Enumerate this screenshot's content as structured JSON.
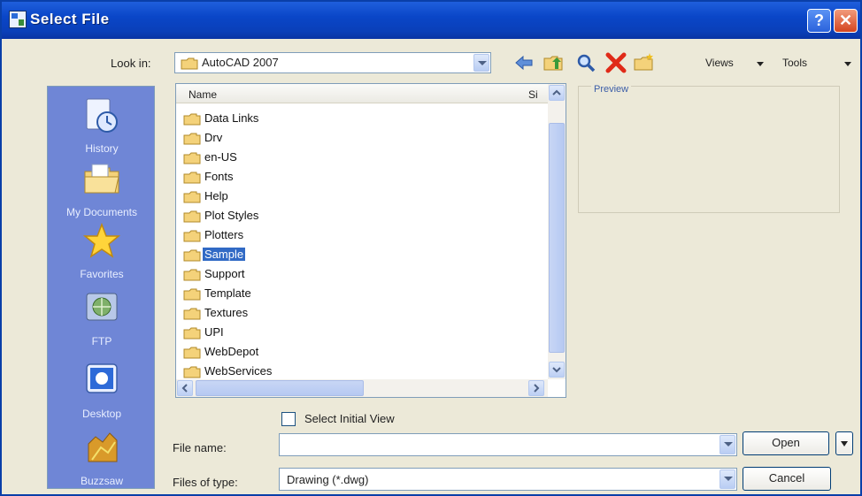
{
  "window": {
    "title": "Select File",
    "help_label": "?",
    "close_label": "✕"
  },
  "lookin": {
    "label": "Look in:",
    "value": "AutoCAD 2007"
  },
  "toolbar": {
    "icons": [
      "back-arrow-icon",
      "up-folder-icon",
      "search-web-icon",
      "delete-icon",
      "create-folder-icon"
    ],
    "views_label": "Views",
    "tools_label": "Tools"
  },
  "places": [
    {
      "label": "History",
      "icon": "history-icon"
    },
    {
      "label": "My Documents",
      "icon": "my-documents-icon"
    },
    {
      "label": "Favorites",
      "icon": "favorites-icon"
    },
    {
      "label": "FTP",
      "icon": "ftp-icon"
    },
    {
      "label": "Desktop",
      "icon": "desktop-icon"
    },
    {
      "label": "Buzzsaw",
      "icon": "buzzsaw-icon"
    }
  ],
  "filelist": {
    "col_name": "Name",
    "col_size": "Si",
    "items": [
      {
        "name": "Data Links",
        "selected": false
      },
      {
        "name": "Drv",
        "selected": false
      },
      {
        "name": "en-US",
        "selected": false
      },
      {
        "name": "Fonts",
        "selected": false
      },
      {
        "name": "Help",
        "selected": false
      },
      {
        "name": "Plot Styles",
        "selected": false
      },
      {
        "name": "Plotters",
        "selected": false
      },
      {
        "name": "Sample",
        "selected": true
      },
      {
        "name": "Support",
        "selected": false
      },
      {
        "name": "Template",
        "selected": false
      },
      {
        "name": "Textures",
        "selected": false
      },
      {
        "name": "UPI",
        "selected": false
      },
      {
        "name": "WebDepot",
        "selected": false
      },
      {
        "name": "WebServices",
        "selected": false
      }
    ]
  },
  "preview": {
    "label": "Preview"
  },
  "select_initial_view": {
    "label": "Select Initial View",
    "checked": false
  },
  "file_name": {
    "label": "File name:",
    "value": ""
  },
  "file_type": {
    "label": "Files of type:",
    "value": "Drawing (*.dwg)"
  },
  "buttons": {
    "open": "Open",
    "cancel": "Cancel"
  },
  "colors": {
    "titlebar": "#0a46c8",
    "places_bg": "#6f86d6",
    "selection": "#316ac5",
    "dialog_bg": "#ece9d8"
  }
}
